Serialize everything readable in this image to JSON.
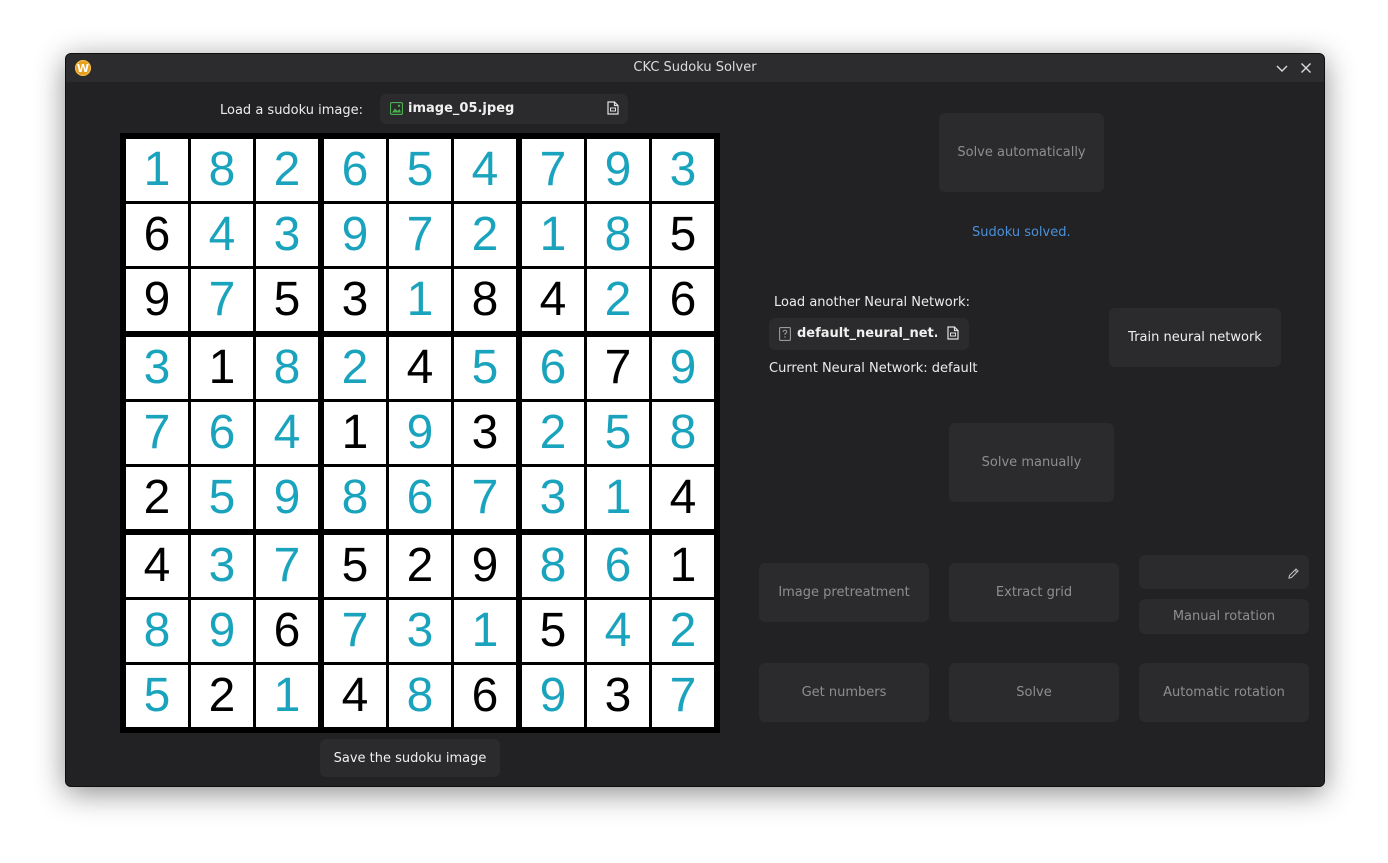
{
  "window": {
    "title": "CKC Sudoku Solver",
    "logo_letter": "W"
  },
  "load_image": {
    "label": "Load a sudoku image:",
    "file_name": "image_05.jpeg"
  },
  "sudoku": {
    "given_color": "#000000",
    "solved_color": "#1aa3bd",
    "grid": [
      [
        1,
        8,
        2,
        6,
        5,
        4,
        7,
        9,
        3
      ],
      [
        6,
        4,
        3,
        9,
        7,
        2,
        1,
        8,
        5
      ],
      [
        9,
        7,
        5,
        3,
        1,
        8,
        4,
        2,
        6
      ],
      [
        3,
        1,
        8,
        2,
        4,
        5,
        6,
        7,
        9
      ],
      [
        7,
        6,
        4,
        1,
        9,
        3,
        2,
        5,
        8
      ],
      [
        2,
        5,
        9,
        8,
        6,
        7,
        3,
        1,
        4
      ],
      [
        4,
        3,
        7,
        5,
        2,
        9,
        8,
        6,
        1
      ],
      [
        8,
        9,
        6,
        7,
        3,
        1,
        5,
        4,
        2
      ],
      [
        5,
        2,
        1,
        4,
        8,
        6,
        9,
        3,
        7
      ]
    ],
    "given_mask": [
      [
        0,
        0,
        0,
        0,
        0,
        0,
        0,
        0,
        0
      ],
      [
        1,
        0,
        0,
        0,
        0,
        0,
        0,
        0,
        1
      ],
      [
        1,
        0,
        1,
        1,
        0,
        1,
        1,
        0,
        1
      ],
      [
        0,
        1,
        0,
        0,
        1,
        0,
        0,
        1,
        0
      ],
      [
        0,
        0,
        0,
        1,
        0,
        1,
        0,
        0,
        0
      ],
      [
        1,
        0,
        0,
        0,
        0,
        0,
        0,
        0,
        1
      ],
      [
        1,
        0,
        0,
        1,
        1,
        1,
        0,
        0,
        1
      ],
      [
        0,
        0,
        1,
        0,
        0,
        0,
        1,
        0,
        0
      ],
      [
        0,
        1,
        0,
        1,
        0,
        1,
        0,
        1,
        0
      ]
    ]
  },
  "save_button": "Save the sudoku image",
  "solve_automatically": "Solve automatically",
  "status": "Sudoku solved.",
  "neural": {
    "load_label": "Load another Neural Network:",
    "file_name": "default_neural_net...",
    "current_label": "Current Neural Network: default"
  },
  "train_button": "Train neural network",
  "solve_manually": "Solve manually",
  "steps": {
    "image_pretreatment": "Image pretreatment",
    "extract_grid": "Extract grid",
    "manual_rotation": "Manual rotation",
    "get_numbers": "Get numbers",
    "solve": "Solve",
    "automatic_rotation": "Automatic rotation"
  },
  "rotation_entry": {
    "value": ""
  }
}
